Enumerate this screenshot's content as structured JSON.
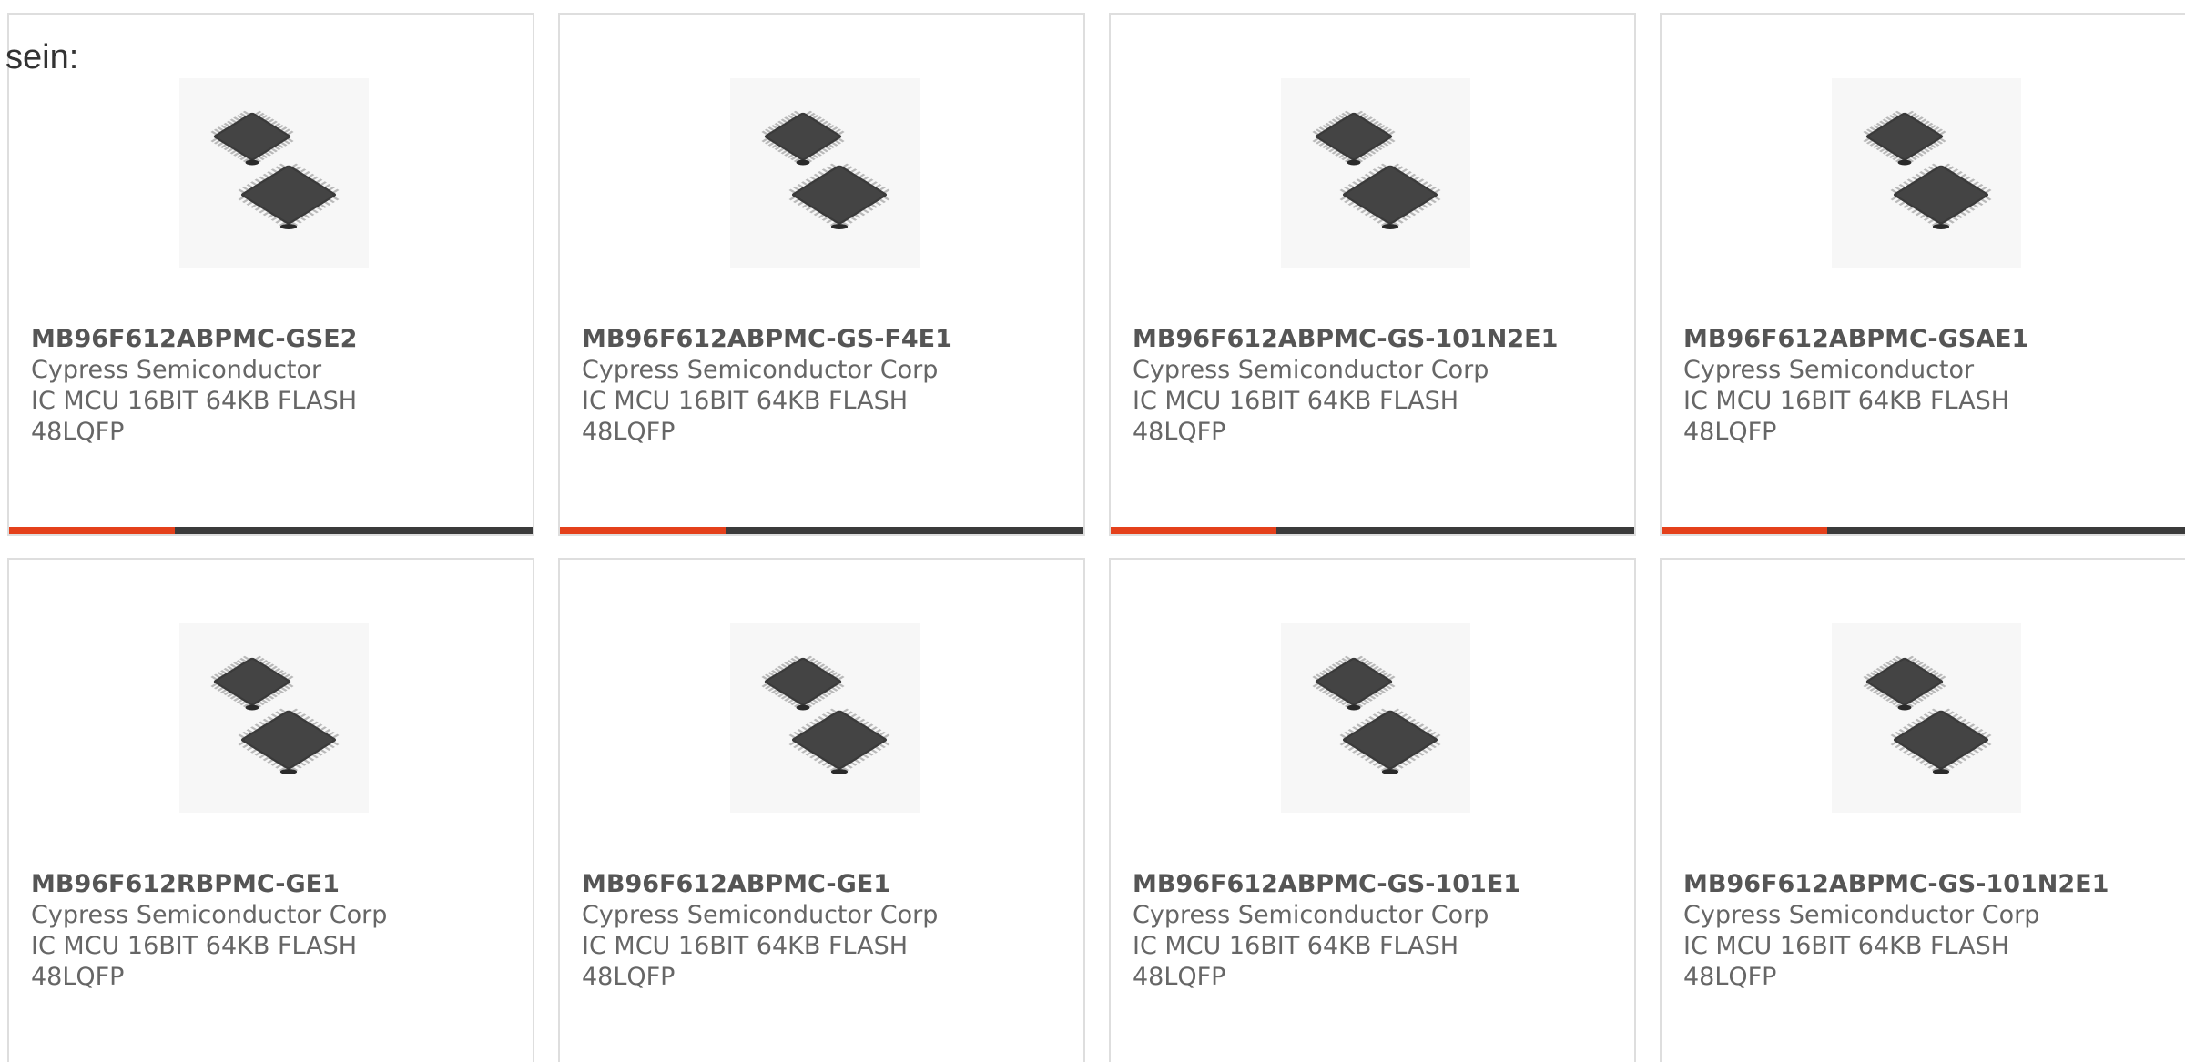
{
  "intro_text": "sein:",
  "colors": {
    "accent": "#e4401b",
    "bar": "#3b3b3b",
    "card_border": "#dedede",
    "text": "#666666"
  },
  "products": [
    {
      "part_no": "MB96F612ABPMC-GSE2",
      "manufacturer": "Cypress Semiconductor",
      "desc_1": "IC MCU 16BIT 64KB FLASH",
      "desc_2": "48LQFP",
      "image_icon": "qfp-chip-image"
    },
    {
      "part_no": "MB96F612ABPMC-GS-F4E1",
      "manufacturer": "Cypress Semiconductor Corp",
      "desc_1": "IC MCU 16BIT 64KB FLASH",
      "desc_2": "48LQFP",
      "image_icon": "qfp-chip-image"
    },
    {
      "part_no": "MB96F612ABPMC-GS-101N2E1",
      "manufacturer": "Cypress Semiconductor Corp",
      "desc_1": "IC MCU 16BIT 64KB FLASH",
      "desc_2": "48LQFP",
      "image_icon": "qfp-chip-image"
    },
    {
      "part_no": "MB96F612ABPMC-GSAE1",
      "manufacturer": "Cypress Semiconductor",
      "desc_1": "IC MCU 16BIT 64KB FLASH",
      "desc_2": "48LQFP",
      "image_icon": "qfp-chip-image"
    },
    {
      "part_no": "MB96F612RBPMC-GE1",
      "manufacturer": "Cypress Semiconductor Corp",
      "desc_1": "IC MCU 16BIT 64KB FLASH",
      "desc_2": "48LQFP",
      "image_icon": "qfp-chip-image"
    },
    {
      "part_no": "MB96F612ABPMC-GE1",
      "manufacturer": "Cypress Semiconductor Corp",
      "desc_1": "IC MCU 16BIT 64KB FLASH",
      "desc_2": "48LQFP",
      "image_icon": "qfp-chip-image"
    },
    {
      "part_no": "MB96F612ABPMC-GS-101E1",
      "manufacturer": "Cypress Semiconductor Corp",
      "desc_1": "IC MCU 16BIT 64KB FLASH",
      "desc_2": "48LQFP",
      "image_icon": "qfp-chip-image"
    },
    {
      "part_no": "MB96F612ABPMC-GS-101N2E1",
      "manufacturer": "Cypress Semiconductor Corp",
      "desc_1": "IC MCU 16BIT 64KB FLASH",
      "desc_2": "48LQFP",
      "image_icon": "qfp-chip-image"
    }
  ]
}
